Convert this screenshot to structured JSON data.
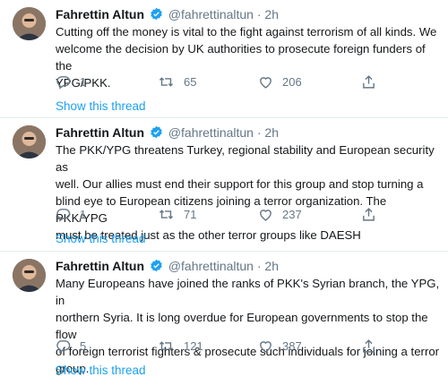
{
  "tweets": [
    {
      "name": "Fahrettin Altun",
      "handle": "@fahrettinaltun",
      "time": "· 2h",
      "lines": [
        "Cutting off the money is vital to the fight against terrorism of all kinds. We",
        "welcome the decision by UK authorities to prosecute foreign funders of the",
        "YPG/PKK."
      ],
      "replies": "1",
      "retweets": "65",
      "likes": "206",
      "thread_link": "Show this thread"
    },
    {
      "name": "Fahrettin Altun",
      "handle": "@fahrettinaltun",
      "time": "· 2h",
      "lines": [
        "The PKK/YPG threatens Turkey, regional stability and European security as",
        "well. Our allies must end their support for this group and stop turning a",
        "blind eye to European citizens joining a terror organization. The PKK/YPG",
        "must be treated just as the other terror groups like DAESH"
      ],
      "replies": "1",
      "retweets": "71",
      "likes": "237",
      "thread_link": "Show this thread"
    },
    {
      "name": "Fahrettin Altun",
      "handle": "@fahrettinaltun",
      "time": "· 2h",
      "lines": [
        "Many Europeans have joined the ranks of PKK's Syrian branch, the YPG, in",
        "northern Syria. It is long overdue for European governments to stop the flow",
        "of foreign terrorist fighters & prosecute such individuals for joining a terror",
        "group."
      ],
      "replies": "5",
      "retweets": "121",
      "likes": "387",
      "thread_link": "Show this thread"
    }
  ],
  "icons": {
    "reply": "reply-icon",
    "retweet": "retweet-icon",
    "like": "heart-icon",
    "share": "share-icon",
    "verified": "verified-badge-icon"
  },
  "colors": {
    "link": "#1da1f2",
    "muted": "#657786",
    "text": "#14171a",
    "separator": "#e6ecf0"
  }
}
